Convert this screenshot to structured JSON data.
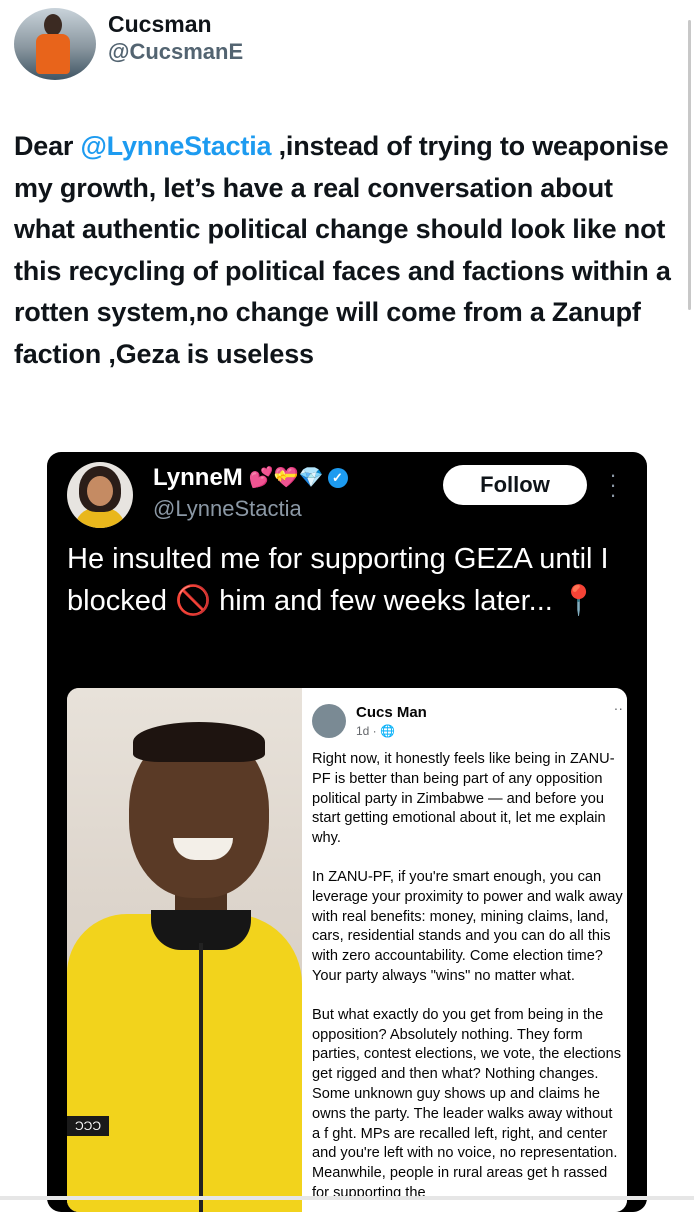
{
  "tweet": {
    "author_name": "Cucsman",
    "author_handle": "@CucsmanE",
    "text_before": "Dear ",
    "mention": "@LynneStactia",
    "text_after": " ,instead of trying to weaponise my growth, let’s have a real conversation about what authentic political change should look like not this recycling of political faces and factions within a rotten system,no change will come from a Zanupf faction ,Geza is useless"
  },
  "quoted": {
    "author_name": "LynneM",
    "emoji": "💕💝💎",
    "verified_icon": "verified-badge-icon",
    "author_handle": "@LynneStactia",
    "follow_label": "Follow",
    "more_icon": "more-vertical-icon",
    "text": "He insulted me for supporting GEZA until I blocked 🚫 him and few weeks later... 📍"
  },
  "screenshot_post": {
    "author": "Cucs Man",
    "meta": "1d · 🌐",
    "more": "··",
    "badge": "ƆƆƆ",
    "paragraphs": [
      "Right now, it honestly feels like being in ZANU-PF is better than being part of any opposition political party in Zimbabwe — and before you start getting emotional about it, let me explain why.",
      "In ZANU-PF, if you're smart enough, you can leverage your proximity to power and walk away with real benefits: money, mining claims, land, cars, residential stands and you can do all this with zero accountability. Come election time? Your party always \"wins\" no matter what.",
      "But what exactly do you get from being in the opposition? Absolutely nothing. They form parties, contest elections, we vote, the elections get rigged and then what? Nothing changes. Some unknown guy shows up and claims he owns the party. The leader walks away without a f ght. MPs are recalled left, right, and center and you're left with no voice, no representation. Meanwhile, people in rural areas get h rassed for supporting the"
    ]
  },
  "colors": {
    "link": "#1d9bf0",
    "verified": "#1d9bf0",
    "embed_bg": "#000000"
  }
}
